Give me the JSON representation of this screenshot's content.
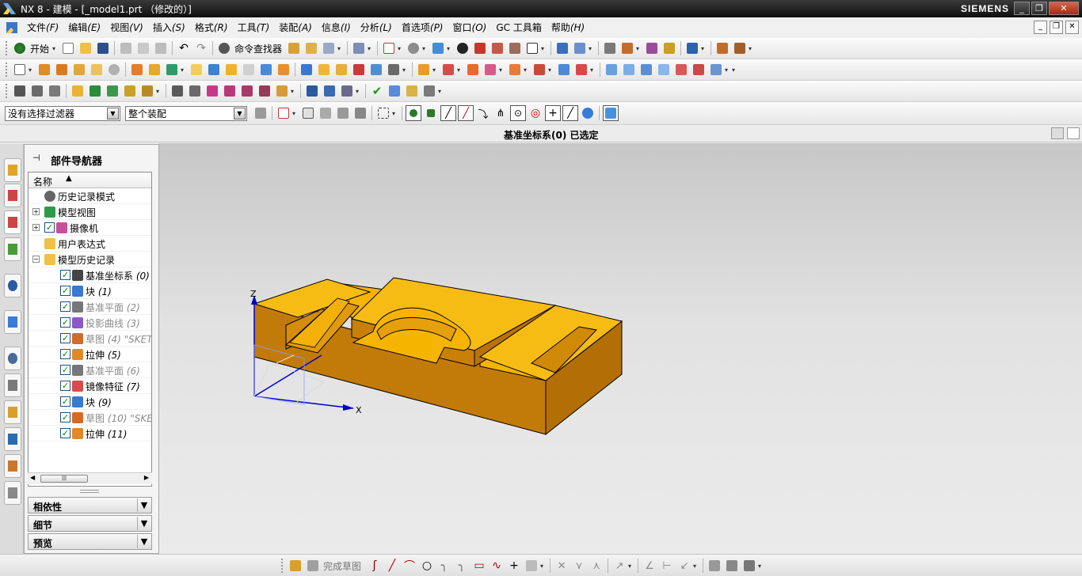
{
  "window": {
    "title": "NX 8 - 建模 - [_model1.prt （修改的）]",
    "brand": "SIEMENS"
  },
  "menu": {
    "items": [
      {
        "label": "文件",
        "key": "(F)"
      },
      {
        "label": "编辑",
        "key": "(E)"
      },
      {
        "label": "视图",
        "key": "(V)"
      },
      {
        "label": "插入",
        "key": "(S)"
      },
      {
        "label": "格式",
        "key": "(R)"
      },
      {
        "label": "工具",
        "key": "(T)"
      },
      {
        "label": "装配",
        "key": "(A)"
      },
      {
        "label": "信息",
        "key": "(I)"
      },
      {
        "label": "分析",
        "key": "(L)"
      },
      {
        "label": "首选项",
        "key": "(P)"
      },
      {
        "label": "窗口",
        "key": "(O)"
      },
      {
        "label": "GC 工具箱",
        "key": ""
      },
      {
        "label": "帮助",
        "key": "(H)"
      }
    ]
  },
  "toolbar": {
    "start_label": "开始",
    "command_finder_label": "命令查找器",
    "selection_filter": "没有选择过滤器",
    "selection_scope": "整个装配"
  },
  "status": {
    "message": "基准坐标系(0) 已选定"
  },
  "navigator": {
    "title": "部件导航器",
    "column_name": "名称",
    "nodes": [
      {
        "label": "历史记录模式",
        "num": "",
        "indent": 0,
        "expander": "",
        "check": false,
        "icon": "clock-icon",
        "muted": false
      },
      {
        "label": "模型视图",
        "num": "",
        "indent": 0,
        "expander": "+",
        "check": false,
        "icon": "model-views-icon",
        "muted": false
      },
      {
        "label": "摄像机",
        "num": "",
        "indent": 0,
        "expander": "+",
        "check": true,
        "icon": "camera-icon",
        "muted": false
      },
      {
        "label": "用户表达式",
        "num": "",
        "indent": 0,
        "expander": "",
        "check": false,
        "icon": "folder-icon",
        "muted": false
      },
      {
        "label": "模型历史记录",
        "num": "",
        "indent": 0,
        "expander": "−",
        "check": false,
        "icon": "folder-open-icon",
        "muted": false
      },
      {
        "label": "基准坐标系",
        "num": "(0)",
        "indent": 1,
        "expander": "",
        "check": true,
        "icon": "datum-csys-icon",
        "muted": false
      },
      {
        "label": "块",
        "num": "(1)",
        "indent": 1,
        "expander": "",
        "check": true,
        "icon": "block-icon",
        "muted": false
      },
      {
        "label": "基准平面",
        "num": "(2)",
        "indent": 1,
        "expander": "",
        "check": true,
        "icon": "datum-plane-icon",
        "muted": true
      },
      {
        "label": "投影曲线",
        "num": "(3)",
        "indent": 1,
        "expander": "",
        "check": true,
        "icon": "projected-curve-icon",
        "muted": true
      },
      {
        "label": "草图",
        "num": "(4) \"SKET",
        "indent": 1,
        "expander": "",
        "check": true,
        "icon": "sketch-icon",
        "muted": true
      },
      {
        "label": "拉伸",
        "num": "(5)",
        "indent": 1,
        "expander": "",
        "check": true,
        "icon": "extrude-icon",
        "muted": false
      },
      {
        "label": "基准平面",
        "num": "(6)",
        "indent": 1,
        "expander": "",
        "check": true,
        "icon": "datum-plane-icon",
        "muted": true
      },
      {
        "label": "镜像特征",
        "num": "(7)",
        "indent": 1,
        "expander": "",
        "check": true,
        "icon": "mirror-feature-icon",
        "muted": false
      },
      {
        "label": "块",
        "num": "(9)",
        "indent": 1,
        "expander": "",
        "check": true,
        "icon": "block-icon",
        "muted": false
      },
      {
        "label": "草图",
        "num": "(10) \"SKE",
        "indent": 1,
        "expander": "",
        "check": true,
        "icon": "sketch-icon",
        "muted": true
      },
      {
        "label": "拉伸",
        "num": "(11)",
        "indent": 1,
        "expander": "",
        "check": true,
        "icon": "extrude-icon",
        "muted": false
      }
    ],
    "sections": [
      "相依性",
      "细节",
      "预览"
    ]
  },
  "viewport": {
    "axis_z": "Z",
    "axis_x": "X",
    "part_color": "#f5b400"
  },
  "bottom_toolbar": {
    "finish_sketch_label": "完成草图"
  }
}
